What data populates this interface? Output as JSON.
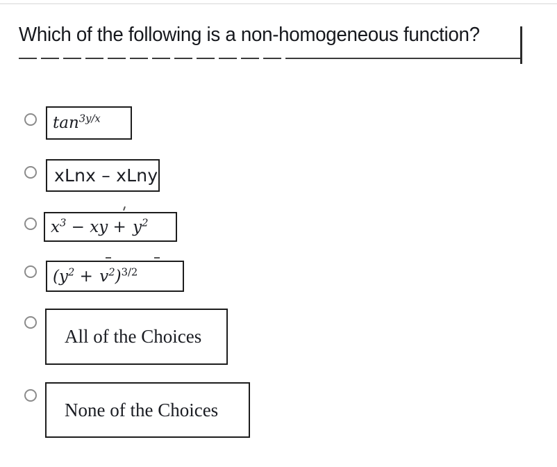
{
  "question": {
    "text": "Which of the following is a non-homogeneous function?"
  },
  "choices": [
    {
      "id": "choice-1",
      "radio_name": "radio-choice-1",
      "style": "math",
      "base": "tan",
      "superscript": "3y/x",
      "plain_text": "tan^(3y/x)"
    },
    {
      "id": "choice-2",
      "radio_name": "radio-choice-2",
      "style": "sans",
      "plain_text": "xLnx – xLny"
    },
    {
      "id": "choice-3",
      "radio_name": "radio-choice-3",
      "style": "math",
      "plain_text": "x³ − xy + y²"
    },
    {
      "id": "choice-4",
      "radio_name": "radio-choice-4",
      "style": "math",
      "plain_text": "(y² + v²)^(3/2)"
    },
    {
      "id": "choice-5",
      "radio_name": "radio-choice-5",
      "style": "serif",
      "plain_text": "All of the Choices"
    },
    {
      "id": "choice-6",
      "radio_name": "radio-choice-6",
      "style": "serif",
      "plain_text": "None of the Choices"
    }
  ],
  "colors": {
    "text": "#1a1c22",
    "box_border": "#1d1d1d",
    "radio_border": "#8b8b8b",
    "hairline": "#d8d8d8",
    "background": "#ffffff"
  }
}
